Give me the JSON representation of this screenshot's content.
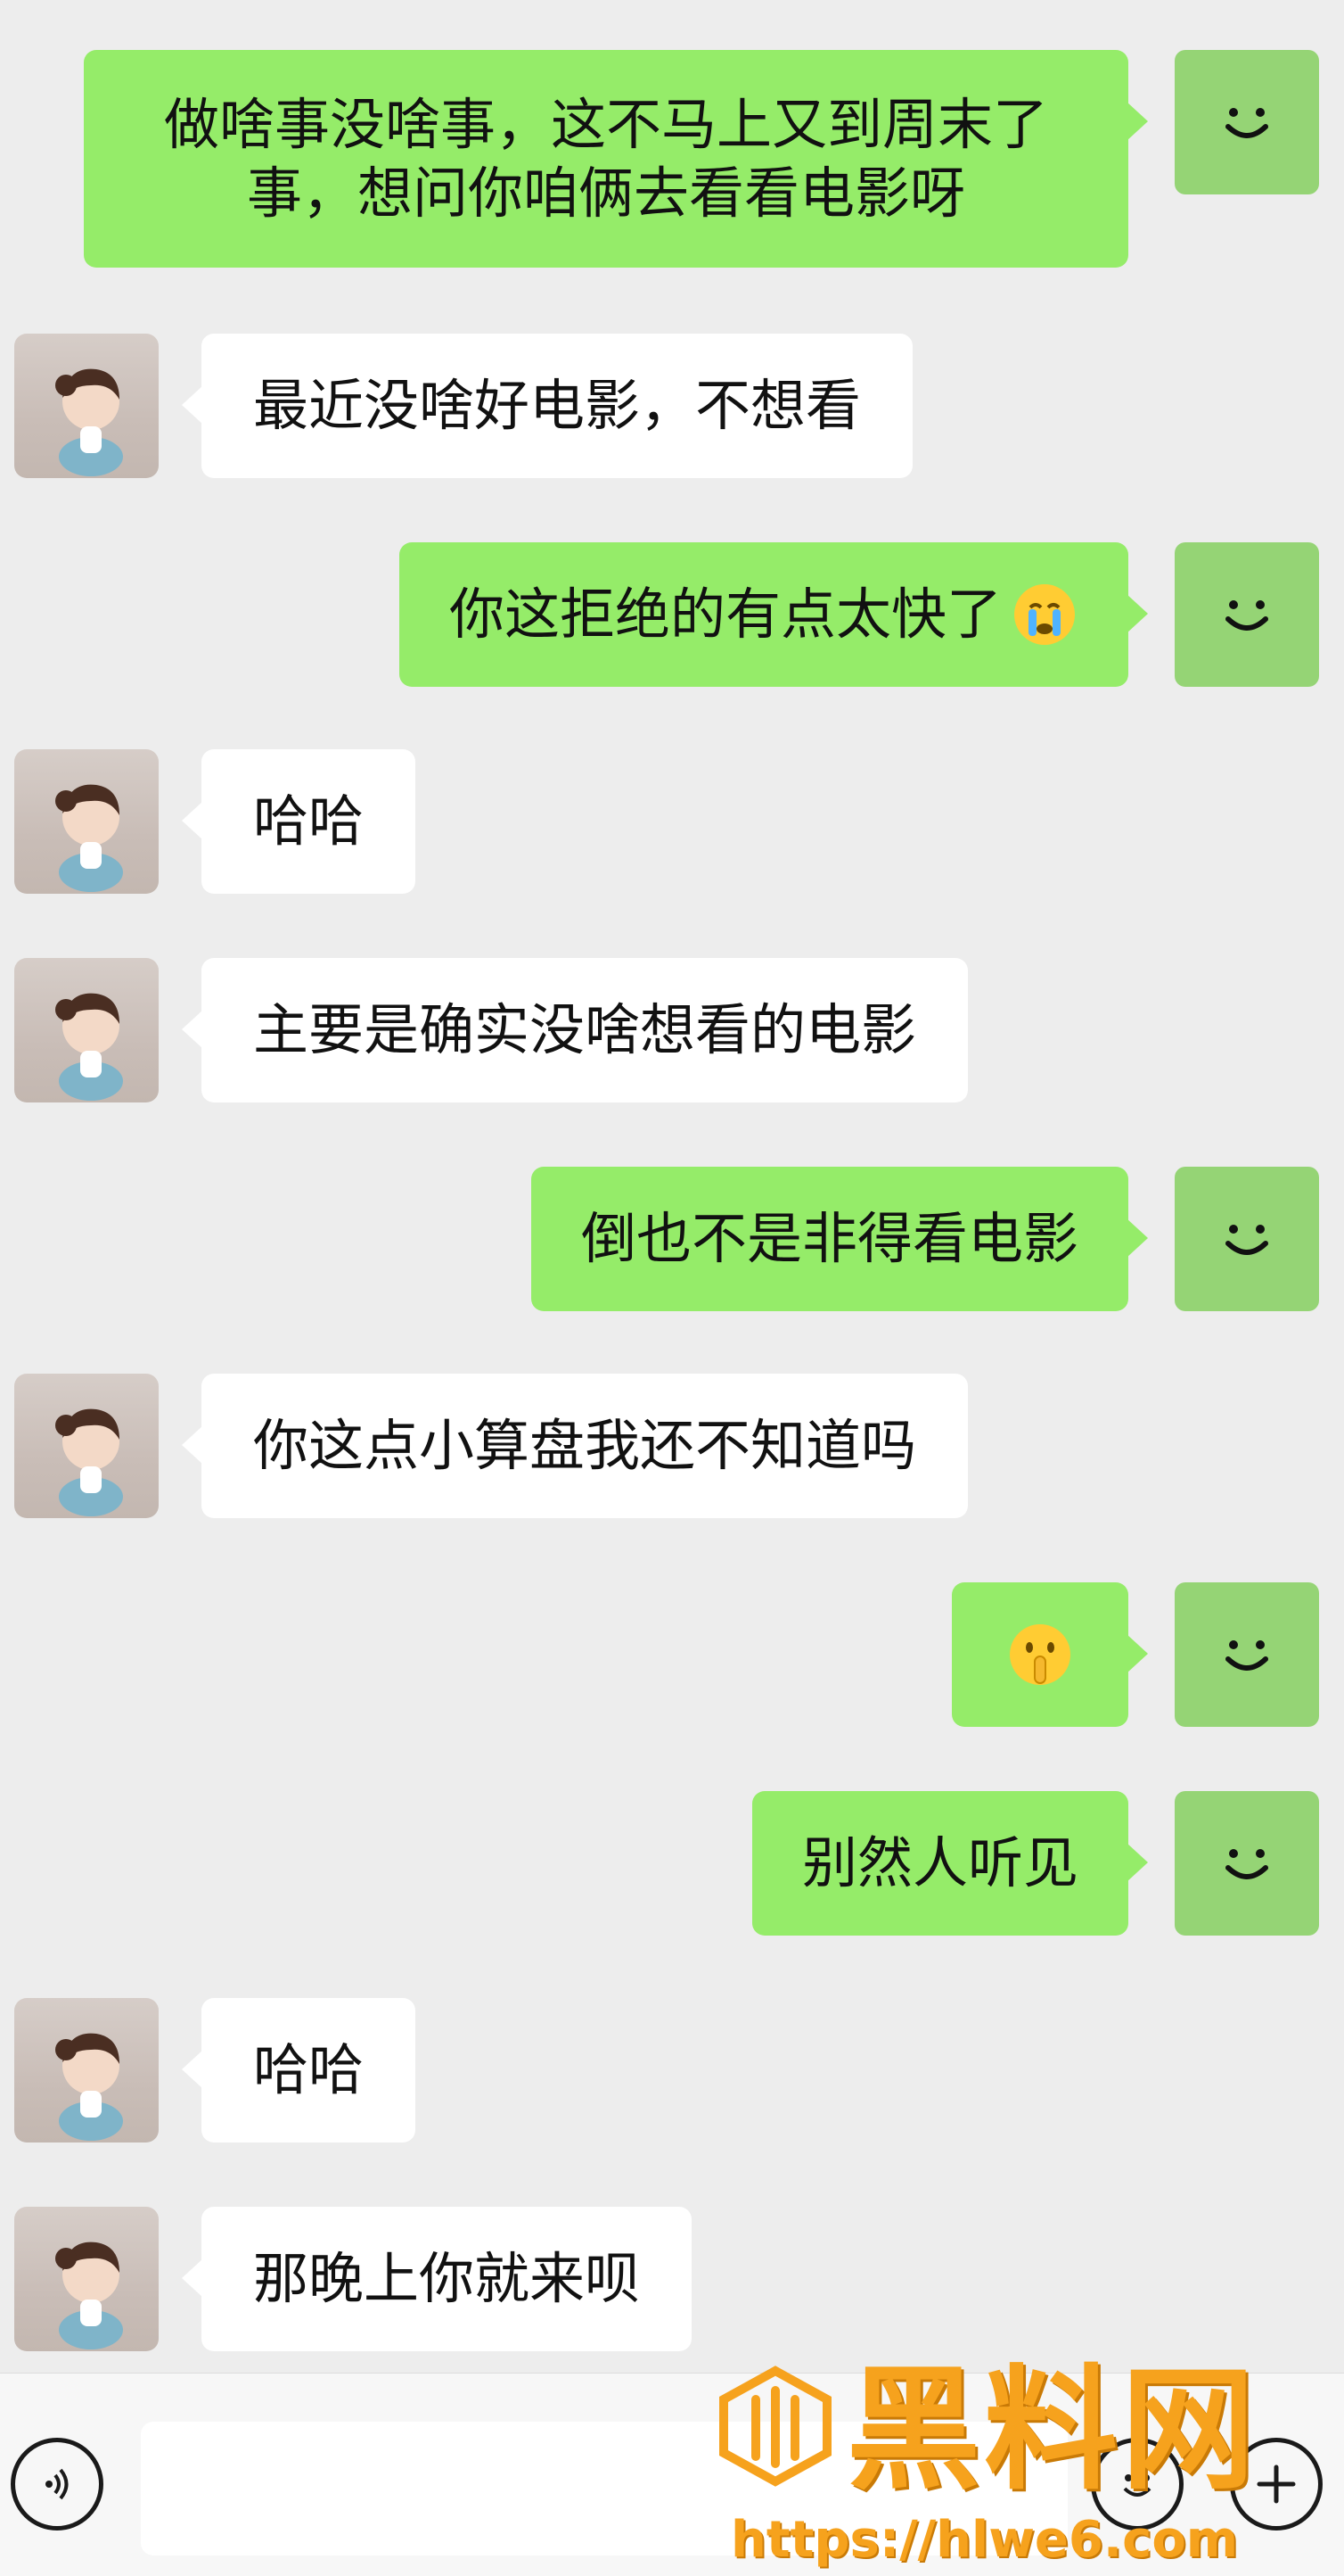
{
  "messages": [
    {
      "from": "me",
      "lines": [
        "做啥事没啥事，这不马上又到周末了",
        "事，想问你咱俩去看看电影呀"
      ]
    },
    {
      "from": "her",
      "text": "最近没啥好电影，不想看"
    },
    {
      "from": "me",
      "text": "你这拒绝的有点太快了",
      "emoji": "crying-face"
    },
    {
      "from": "her",
      "text": "哈哈"
    },
    {
      "from": "her",
      "text": "主要是确实没啥想看的电影"
    },
    {
      "from": "me",
      "text": "倒也不是非得看电影"
    },
    {
      "from": "her",
      "text": "你这点小算盘我还不知道吗"
    },
    {
      "from": "me",
      "text": "",
      "emoji": "shushing-face"
    },
    {
      "from": "me",
      "text": "别然人听见"
    },
    {
      "from": "her",
      "text": "哈哈"
    },
    {
      "from": "her",
      "text": "那晚上你就来呗"
    }
  ],
  "input_bar": {
    "voice_icon": "voice-icon",
    "emoji_icon": "emoji-icon",
    "plus_icon": "plus-icon",
    "input_value": ""
  },
  "watermark": {
    "brand": "黑料网",
    "url": "https://hlwe6.com",
    "color": "#f6a21d"
  },
  "colors": {
    "background": "#ededed",
    "my_bubble": "#95ec69",
    "her_bubble": "#ffffff",
    "my_avatar": "#95d475"
  }
}
